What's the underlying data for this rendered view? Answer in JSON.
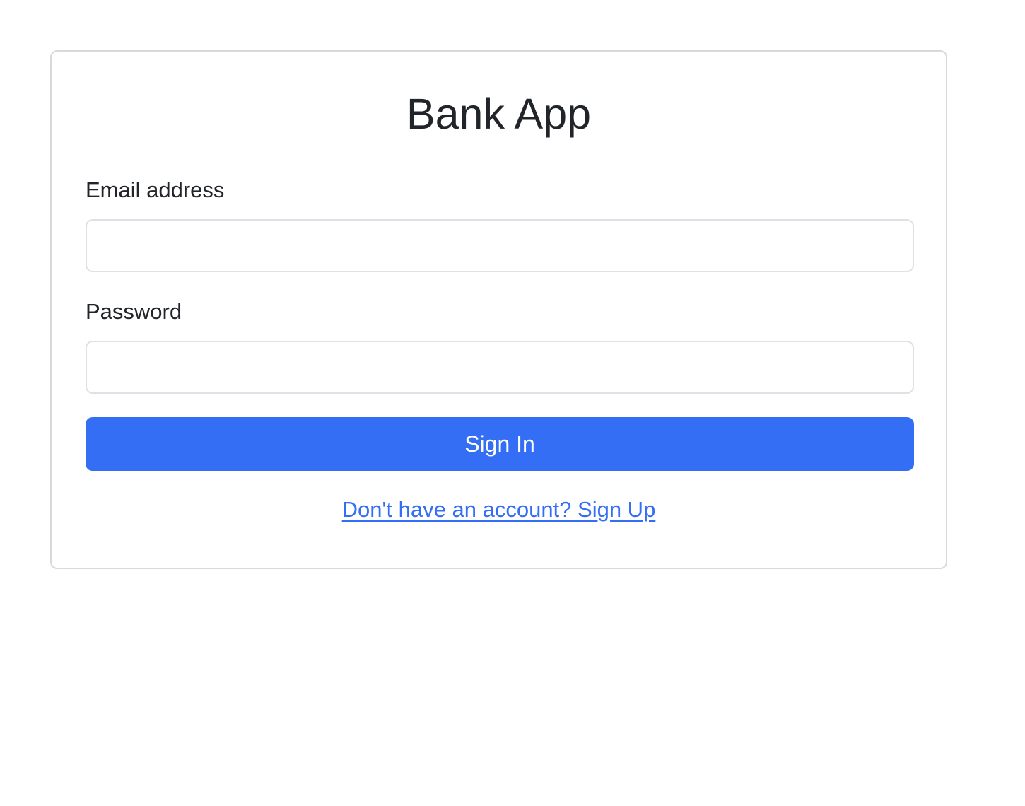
{
  "app": {
    "title": "Bank App"
  },
  "form": {
    "email_label": "Email address",
    "email_value": "",
    "password_label": "Password",
    "password_value": "",
    "submit_label": "Sign In",
    "signup_link": "Don't have an account? Sign Up"
  },
  "colors": {
    "primary": "#346ef5",
    "border": "#dee2e6",
    "text": "#212529"
  }
}
